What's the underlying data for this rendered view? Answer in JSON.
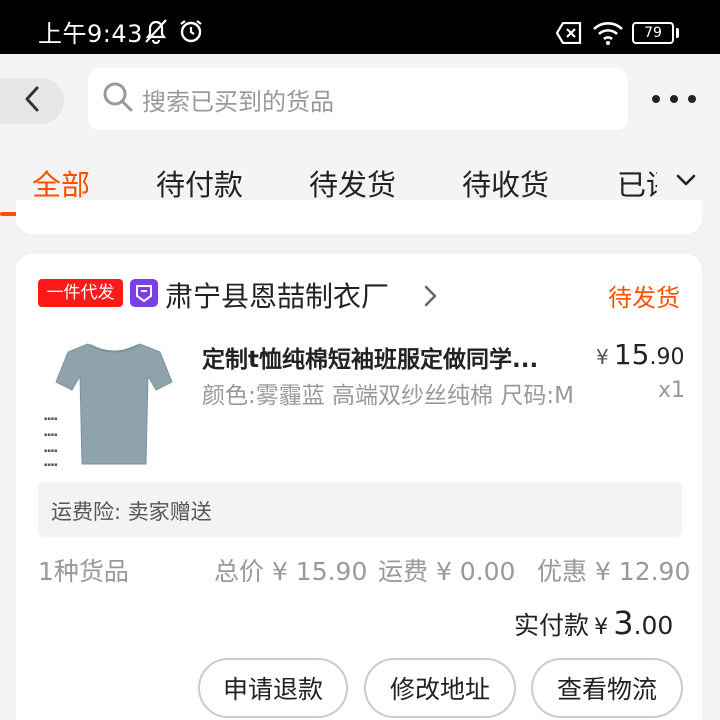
{
  "status_bar": {
    "time": "上午9:43",
    "battery": "79",
    "icons": [
      "bell-muted-icon",
      "alarm-icon",
      "no-sim-icon",
      "wifi-icon",
      "battery-icon"
    ]
  },
  "header": {
    "back_icon": "chevron-left-icon",
    "search_icon": "search-icon",
    "search_placeholder": "搜索已买到的货品",
    "more_icon": "more-dots-icon"
  },
  "tabs": [
    {
      "label": "全部",
      "active": true
    },
    {
      "label": "待付款",
      "active": false
    },
    {
      "label": "待发货",
      "active": false
    },
    {
      "label": "待收货",
      "active": false
    },
    {
      "label": "已评价",
      "active": false
    }
  ],
  "tabs_dropdown_icon": "chevron-down-icon",
  "order": {
    "badge": "一件代发",
    "shop_logo_icon": "shop-logo-icon",
    "shop_name": "肃宁县恩喆制衣厂",
    "status": "待发货",
    "product": {
      "title": "定制t恤纯棉短袖班服定做同学...",
      "sku": "颜色:雾霾蓝 高端双纱丝纯棉 尺码:M",
      "price_currency": "¥",
      "price_int": "15",
      "price_dec": ".90",
      "qty": "x1",
      "thumb_color": "#8fa3ad"
    },
    "insurance": "运费险:  卖家赠送",
    "summary": {
      "count": "1种货品",
      "total": "总价 ¥ 15.90",
      "shipping": "运费 ¥ 0.00",
      "discount": "优惠 ¥ 12.90"
    },
    "paid": {
      "label": "实付款",
      "currency": "¥",
      "int": "3",
      "dec": ".00"
    },
    "actions": [
      "申请退款",
      "修改地址",
      "查看物流"
    ]
  },
  "colors": {
    "accent": "#ff5000",
    "badge_red": "#ff1a1a",
    "shop_logo": "#7b3fe4"
  }
}
